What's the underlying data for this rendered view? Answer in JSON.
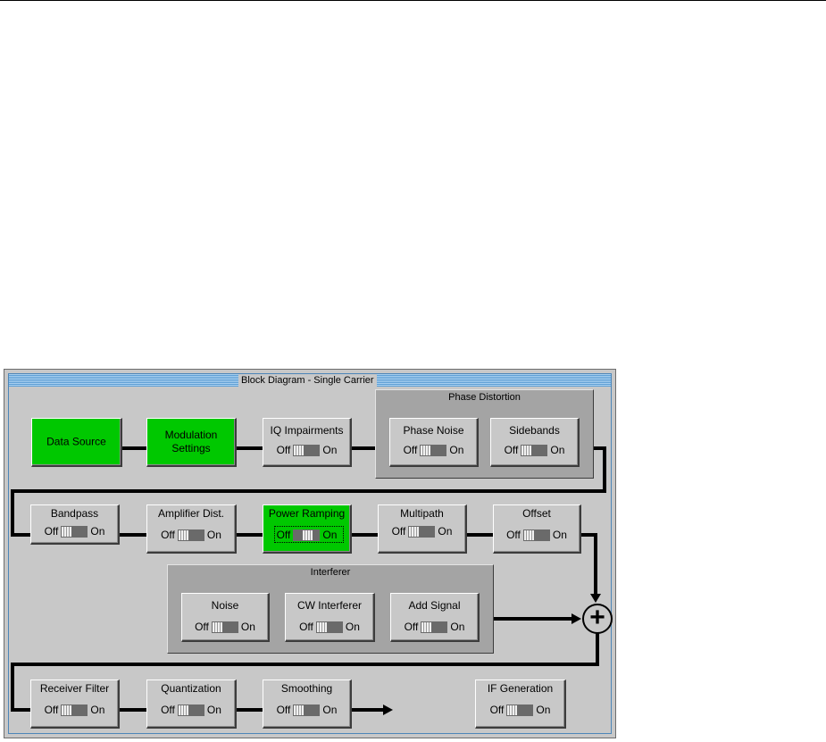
{
  "window_title": "Block Diagram - Single Carrier",
  "toggle_off": "Off",
  "toggle_on": "On",
  "groups": {
    "phase_distortion": "Phase Distortion",
    "interferer": "Interferer"
  },
  "blocks": {
    "data_source": "Data Source",
    "modulation_line1": "Modulation",
    "modulation_line2": "Settings",
    "iq_impairments": "IQ Impairments",
    "phase_noise": "Phase Noise",
    "sidebands": "Sidebands",
    "bandpass": "Bandpass",
    "amplifier_dist": "Amplifier Dist.",
    "power_ramping": "Power Ramping",
    "multipath": "Multipath",
    "offset": "Offset",
    "noise": "Noise",
    "cw_interferer": "CW Interferer",
    "add_signal": "Add Signal",
    "receiver_filter": "Receiver Filter",
    "quantization": "Quantization",
    "smoothing": "Smoothing",
    "if_generation": "IF Generation"
  },
  "sum_symbol": "+",
  "colors": {
    "active": "#00c800",
    "panel": "#c8c8c8",
    "group": "#a4a4a4",
    "titlebar": "#5f9fd5"
  }
}
